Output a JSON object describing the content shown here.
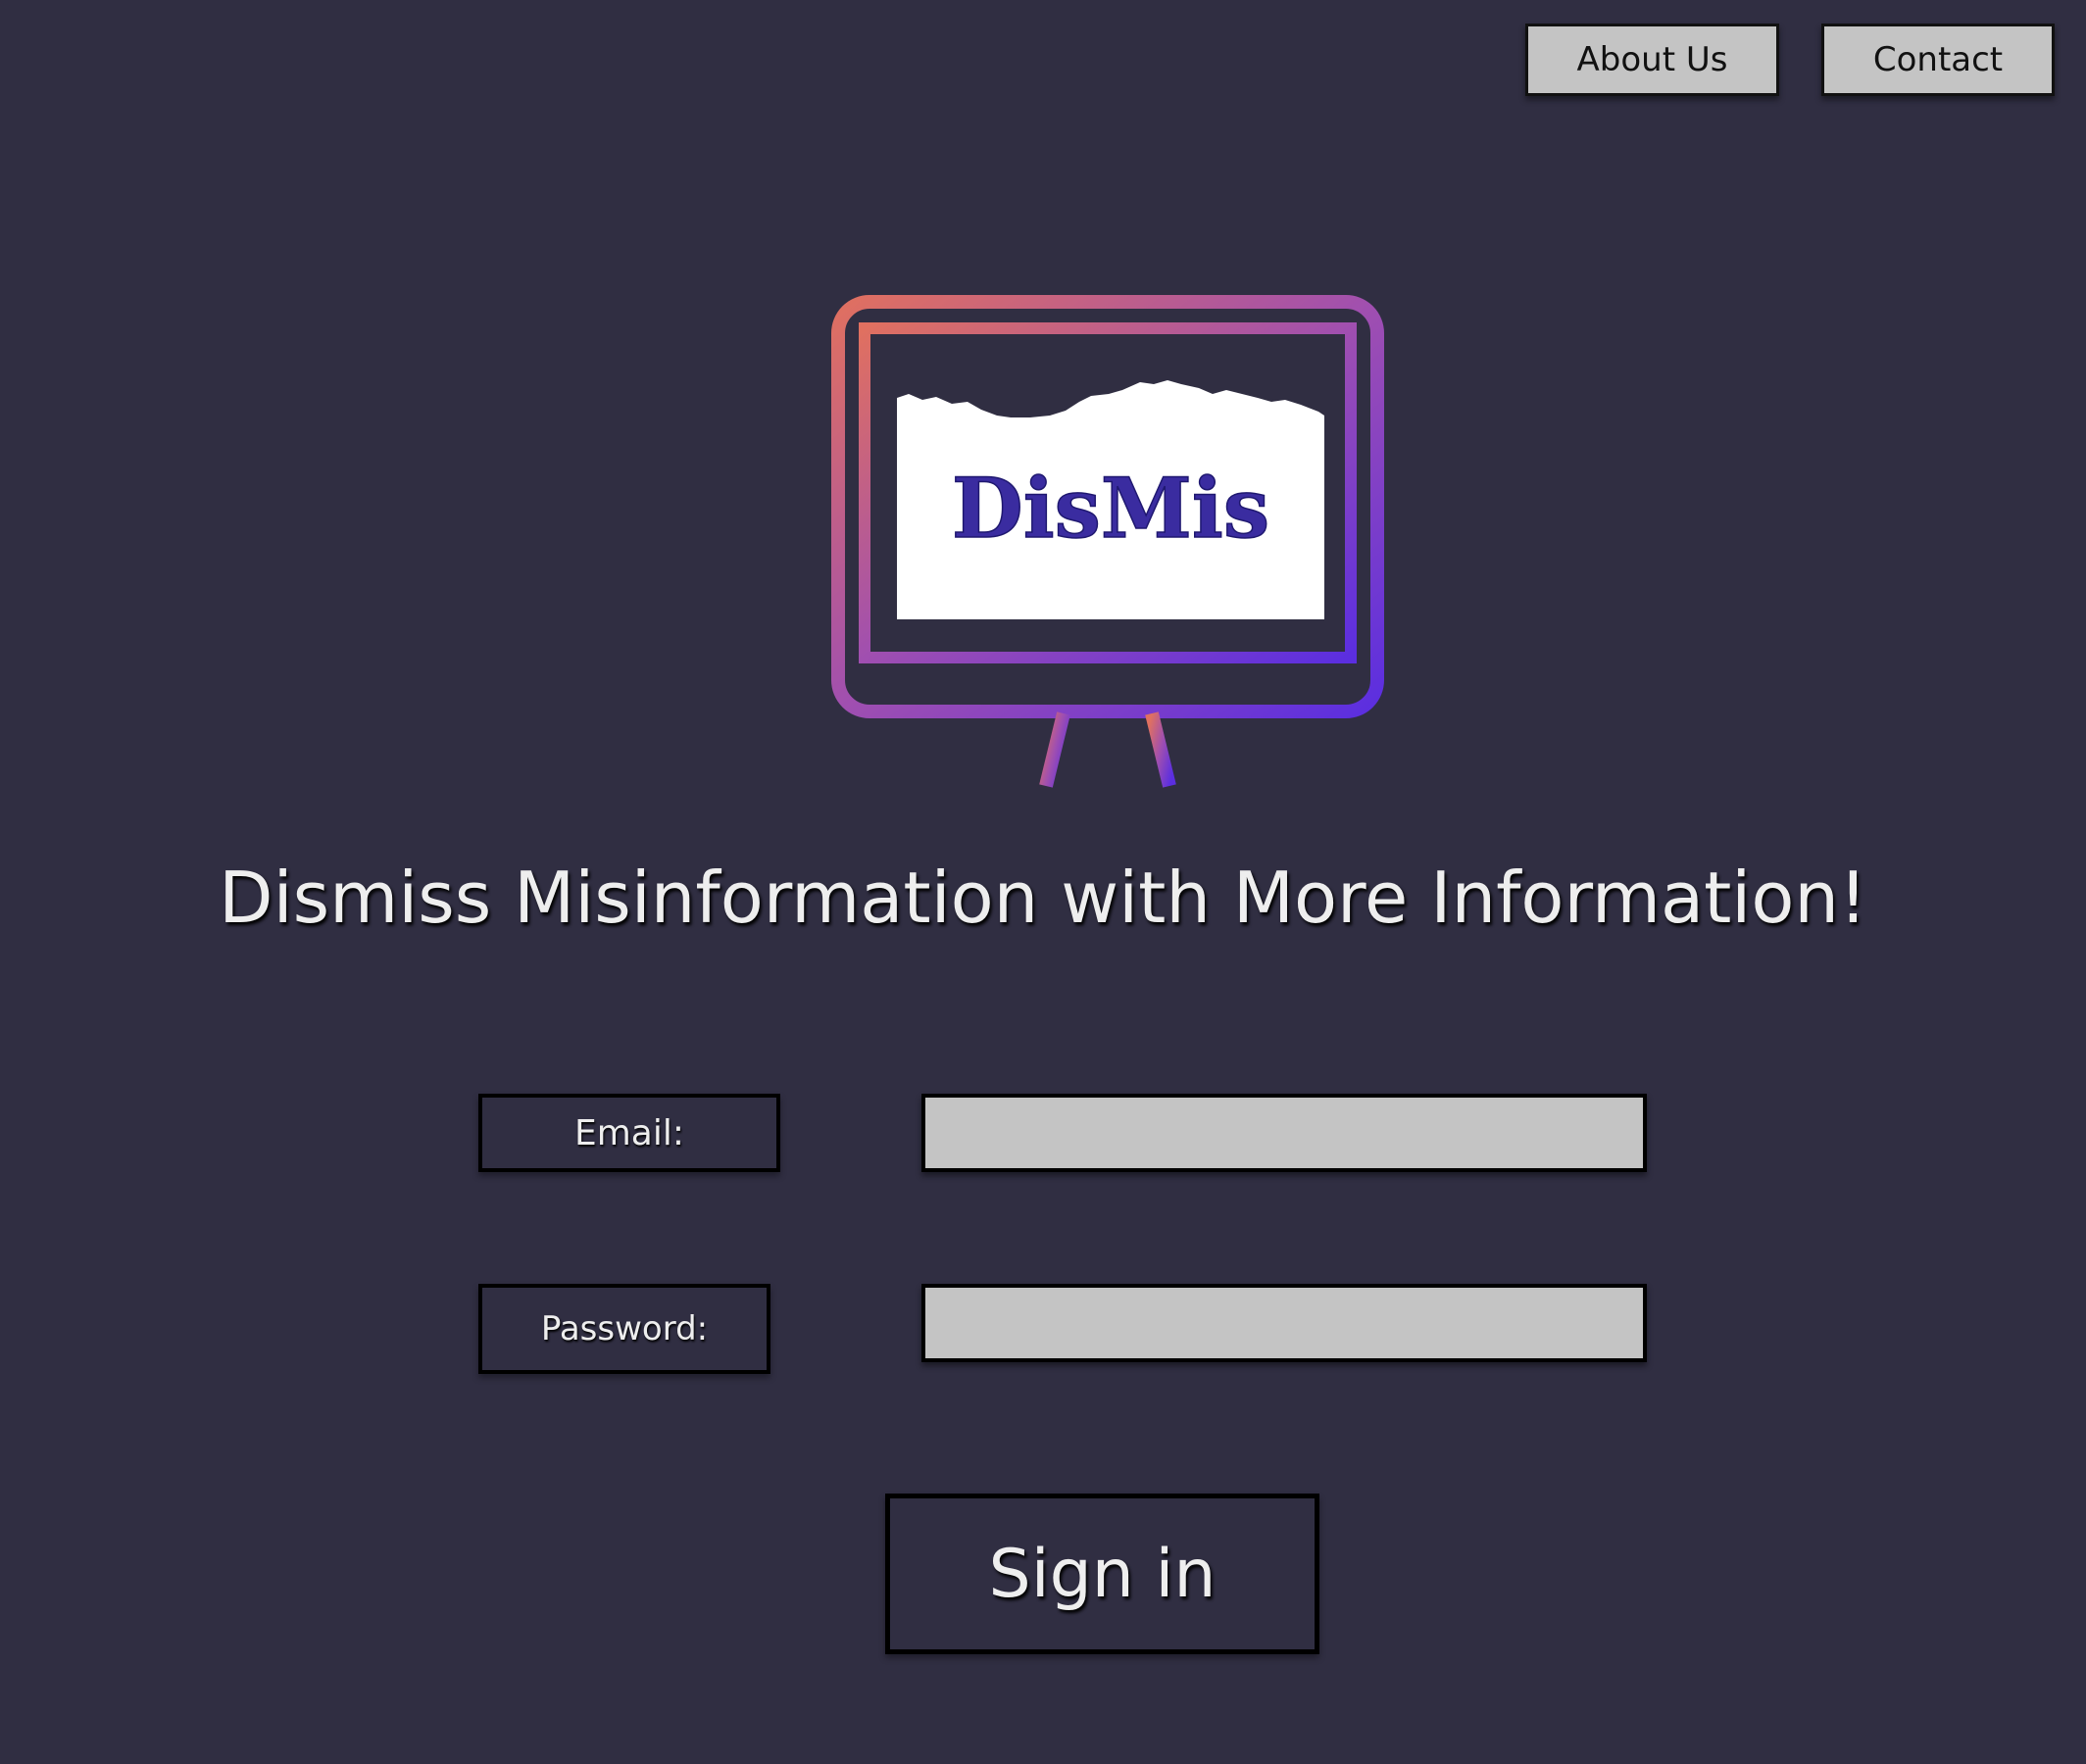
{
  "header": {
    "about_label": "About Us",
    "contact_label": "Contact"
  },
  "logo": {
    "wordmark": "DisMis"
  },
  "tagline": "Dismiss Misinformation with More Information!",
  "form": {
    "email_label": "Email:",
    "email_value": "",
    "password_label": "Password:",
    "password_value": "",
    "signin_label": "Sign in"
  },
  "colors": {
    "background": "#302e42",
    "button_gray": "#c4c4c4",
    "logo_gradient_start": "#e07060",
    "logo_gradient_end": "#5b2ee0",
    "wordmark": "#3a2ca0"
  }
}
